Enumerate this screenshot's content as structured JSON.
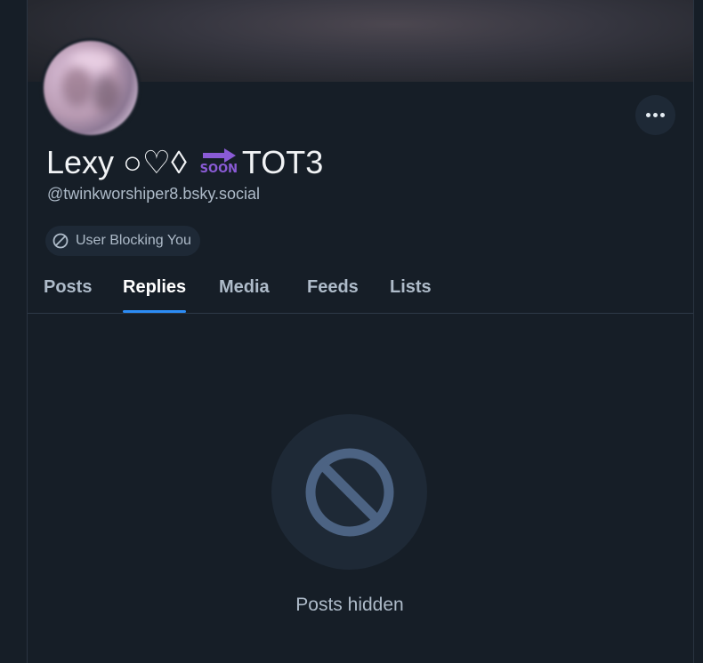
{
  "profile": {
    "display_name_prefix": "Lexy ○♡◊",
    "display_name_suffix": "TOT3",
    "emoji_soon_label": "SOON",
    "handle": "@twinkworshiper8.bsky.social",
    "block_badge": "User Blocking You"
  },
  "tabs": [
    {
      "label": "Posts",
      "active": false
    },
    {
      "label": "Replies",
      "active": true
    },
    {
      "label": "Media",
      "active": false
    },
    {
      "label": "Feeds",
      "active": false
    },
    {
      "label": "Lists",
      "active": false
    }
  ],
  "empty_state": {
    "message": "Posts hidden",
    "icon": "blocked-icon"
  },
  "colors": {
    "background": "#161e27",
    "accent": "#2c8cf5",
    "muted_text": "#aebbc9",
    "surface": "#1e2936"
  }
}
